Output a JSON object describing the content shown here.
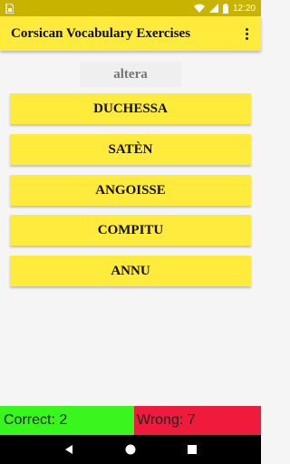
{
  "status_bar": {
    "time": "12:20",
    "icons": [
      "sim-card-icon",
      "wifi-icon",
      "signal-icon",
      "battery-icon"
    ]
  },
  "app_bar": {
    "title": "Corsican Vocabulary Exercises",
    "menu_icon": "overflow-menu-icon"
  },
  "question": {
    "word": "altera"
  },
  "answers": [
    {
      "label": "DUCHESSA"
    },
    {
      "label": "SATÈN"
    },
    {
      "label": "ANGOISSE"
    },
    {
      "label": "COMPITU"
    },
    {
      "label": "ANNU"
    }
  ],
  "score": {
    "correct_label": "Correct: 2",
    "wrong_label": "Wrong: 7"
  },
  "nav_bar": {
    "icons": [
      "back-icon",
      "home-icon",
      "recents-icon"
    ]
  },
  "colors": {
    "status_bar": "#c8b400",
    "app_bar": "#ffeb3b",
    "answer_button": "#ffeb3b",
    "correct": "#38f71c",
    "wrong": "#ee1b3d",
    "background": "#f5f5f5"
  }
}
